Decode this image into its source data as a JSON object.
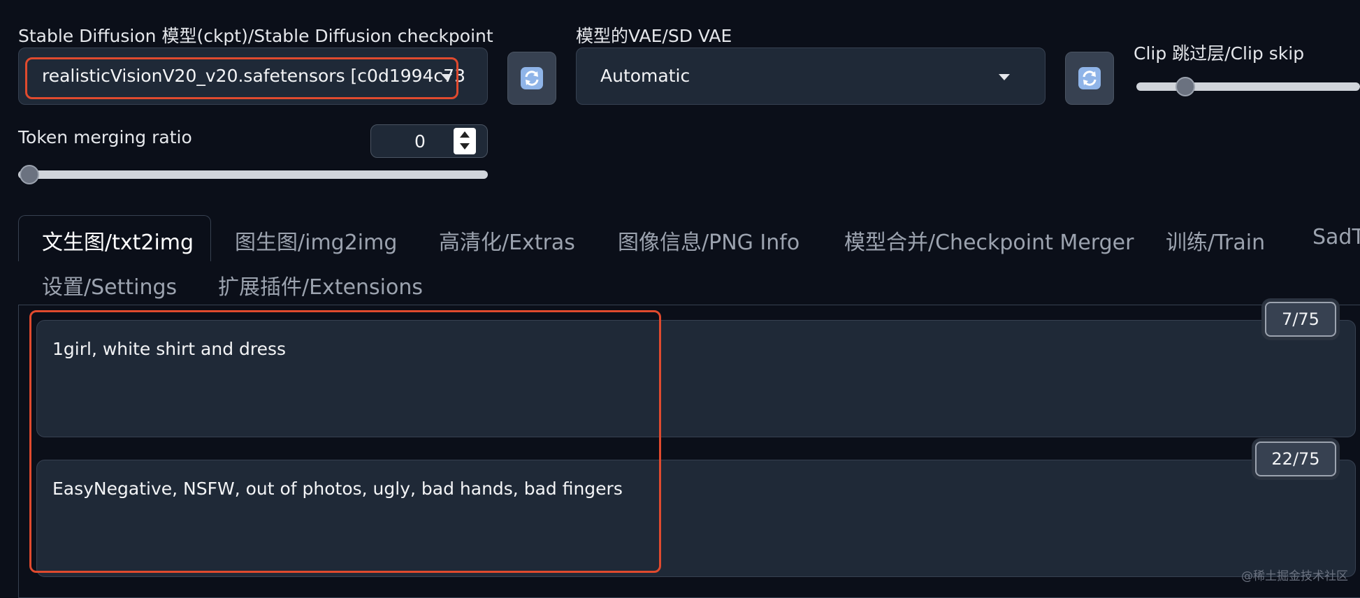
{
  "settings": {
    "checkpoint": {
      "label": "Stable Diffusion 模型(ckpt)/Stable Diffusion checkpoint",
      "value": "realisticVisionV20_v20.safetensors [c0d1994c73"
    },
    "vae": {
      "label": "模型的VAE/SD VAE",
      "value": "Automatic"
    },
    "clip_skip": {
      "label": "Clip 跳过层/Clip skip"
    },
    "token_merging": {
      "label": "Token merging ratio",
      "value": "0"
    }
  },
  "tabs": [
    {
      "label": "文生图/txt2img",
      "active": true
    },
    {
      "label": "图生图/img2img"
    },
    {
      "label": "高清化/Extras"
    },
    {
      "label": "图像信息/PNG Info"
    },
    {
      "label": "模型合并/Checkpoint Merger"
    },
    {
      "label": "训练/Train"
    },
    {
      "label": "SadT"
    },
    {
      "label": "设置/Settings"
    },
    {
      "label": "扩展插件/Extensions"
    }
  ],
  "prompt": {
    "text": "1girl, white shirt and dress",
    "token_count": "7/75"
  },
  "negative_prompt": {
    "text": "EasyNegative, NSFW, out of photos, ugly, bad hands, bad fingers",
    "token_count": "22/75"
  },
  "watermark": "@稀土掘金技术社区",
  "colors": {
    "background": "#0b0f19",
    "panel": "#1f2937",
    "highlight": "#e04a2e"
  },
  "icons": [
    "refresh-icon",
    "chevron-down-icon",
    "spinner-up-icon",
    "spinner-down-icon"
  ]
}
